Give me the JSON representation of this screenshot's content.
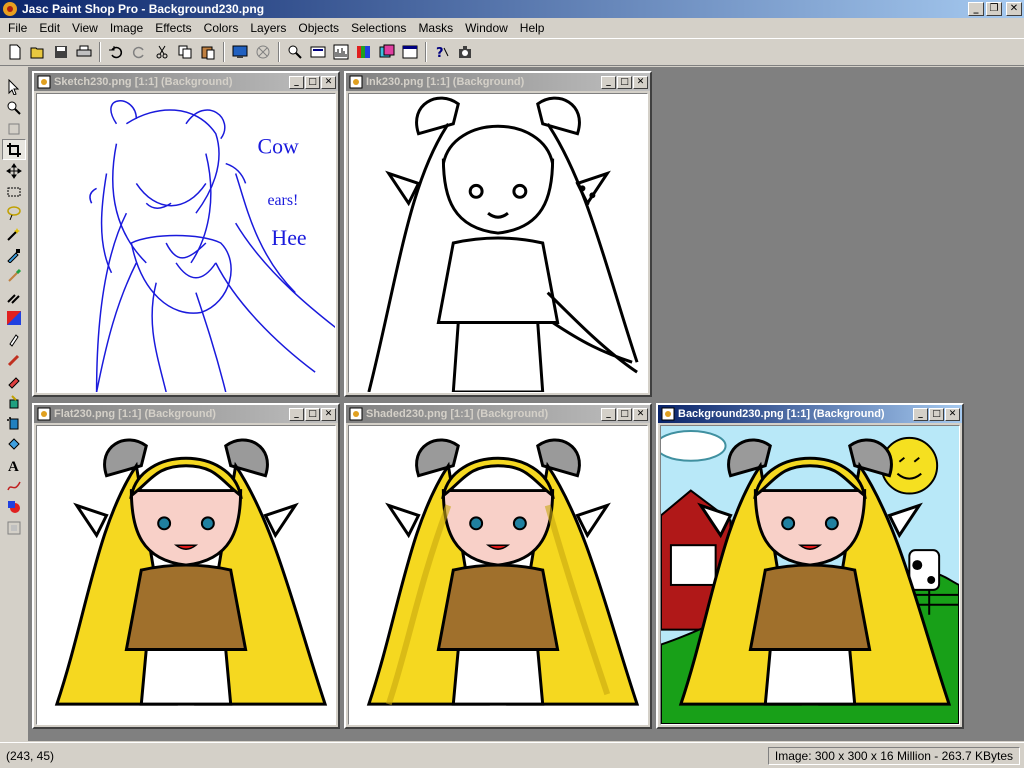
{
  "window": {
    "title": "Jasc Paint Shop Pro - Background230.png"
  },
  "menu": [
    "File",
    "Edit",
    "View",
    "Image",
    "Effects",
    "Colors",
    "Layers",
    "Objects",
    "Selections",
    "Masks",
    "Window",
    "Help"
  ],
  "toolbar": {
    "icons": [
      "new-icon",
      "open-icon",
      "save-icon",
      "print-icon",
      "undo-icon",
      "redo-icon",
      "cut-icon",
      "copy-icon",
      "paste-icon",
      "browse-icon",
      "screen-capture-icon",
      "zoom-view-icon",
      "overview-icon",
      "histogram-icon",
      "color-palette-icon",
      "layers-palette-icon",
      "tool-options-icon",
      "help-icon",
      "color-dialog-icon"
    ]
  },
  "tools": [
    "arrow-tool-icon",
    "zoom-tool-icon",
    "deform-tool-icon",
    "crop-tool-icon",
    "mover-tool-icon",
    "selection-tool-icon",
    "freehand-selection-icon",
    "magic-wand-icon",
    "dropper-icon",
    "paintbrush-icon",
    "clone-brush-icon",
    "color-replacer-icon",
    "retouch-icon",
    "scratch-remover-icon",
    "eraser-icon",
    "picture-tube-icon",
    "airbrush-icon",
    "flood-fill-icon",
    "text-tool-icon",
    "draw-tool-icon",
    "preset-shapes-icon",
    "object-selector-icon"
  ],
  "documents": [
    {
      "id": "sketch",
      "title": "Sketch230.png [1:1] (Background)",
      "active": false
    },
    {
      "id": "ink",
      "title": "Ink230.png [1:1] (Background)",
      "active": false
    },
    {
      "id": "flat",
      "title": "Flat230.png [1:1] (Background)",
      "active": false
    },
    {
      "id": "shaded",
      "title": "Shaded230.png [1:1] (Background)",
      "active": false
    },
    {
      "id": "background",
      "title": "Background230.png [1:1] (Background)",
      "active": true
    }
  ],
  "sketch_note": [
    "Cow",
    "ears!",
    "Hee"
  ],
  "status": {
    "coords": "(243, 45)",
    "image_info": "Image:  300 x 300 x 16 Million - 263.7 KBytes"
  },
  "colors": {
    "active_title": "#0a246a",
    "inactive_title": "#808080",
    "workspace": "#808080",
    "sketch_blue": "#1a1adc",
    "hair_yellow": "#f5d820",
    "shirt_brown": "#a0702c",
    "sky": "#b8e8f8",
    "grass": "#18a018",
    "barn_red": "#b01818"
  }
}
